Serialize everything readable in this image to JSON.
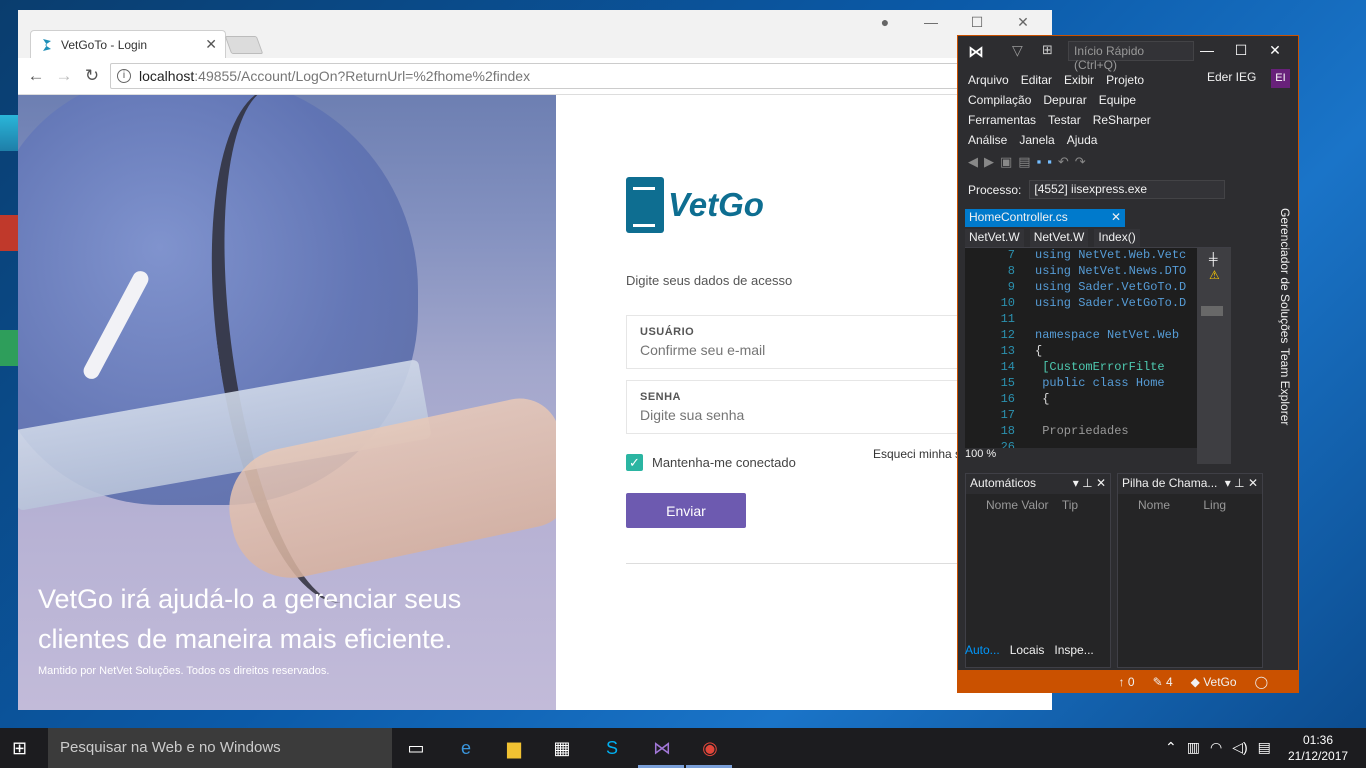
{
  "browser": {
    "tab_title": "VetGoTo - Login",
    "url_host": "localhost",
    "url_path": ":49855/Account/LogOn?ReturnUrl=%2fhome%2findex"
  },
  "login": {
    "logo_text": "VetGo",
    "intro": "Digite seus dados de acesso",
    "user_label": "USUÁRIO",
    "user_placeholder": "Confirme seu e-mail",
    "pass_label": "SENHA",
    "pass_placeholder": "Digite sua senha",
    "remember_label": "Mantenha-me conectado",
    "remember_checked": true,
    "forgot_label": "Esqueci minha s",
    "submit_label": "Enviar"
  },
  "hero": {
    "headline": "VetGo irá ajudá-lo a gerenciar seus clientes de maneira mais eficiente.",
    "footer": "Mantido por NetVet Soluções. Todos os direitos reservados."
  },
  "vs": {
    "quick_launch": "Início Rápido (Ctrl+Q)",
    "menu": [
      "Arquivo",
      "Editar",
      "Exibir",
      "Projeto",
      "Compilação",
      "Depurar",
      "Equipe",
      "Ferramentas",
      "Testar",
      "ReSharper",
      "Análise",
      "Janela",
      "Ajuda"
    ],
    "user": "Eder IEG",
    "avatar": "EI",
    "process_label": "Processo:",
    "process_value": "[4552] iisexpress.exe",
    "doc_tab": "HomeController.cs",
    "nav": [
      "NetVet.W",
      "NetVet.W",
      "Index()"
    ],
    "code": [
      {
        "n": "7",
        "t": "using NetVet.Web.Vetc"
      },
      {
        "n": "8",
        "t": "using NetVet.News.DTO"
      },
      {
        "n": "9",
        "t": "using Sader.VetGoTo.D"
      },
      {
        "n": "10",
        "t": "using Sader.VetGoTo.D"
      },
      {
        "n": "11",
        "t": ""
      },
      {
        "n": "12",
        "t": "namespace NetVet.Web"
      },
      {
        "n": "13",
        "t": "{"
      },
      {
        "n": "14",
        "t": "    [CustomErrorFilte"
      },
      {
        "n": "15",
        "t": "    public class Home"
      },
      {
        "n": "16",
        "t": "    {"
      },
      {
        "n": "17",
        "t": ""
      },
      {
        "n": "18",
        "t": "        Propriedades"
      },
      {
        "n": "26",
        "t": ""
      }
    ],
    "zoom": "100 %",
    "side_tabs": [
      "Gerenciador de Soluções",
      "Team Explorer"
    ],
    "pane_left_title": "Automáticos",
    "pane_left_cols": [
      "Nome",
      "Valor",
      "Tip"
    ],
    "pane_right_title": "Pilha de Chama...",
    "pane_right_cols": [
      "Nome",
      "Ling"
    ],
    "bottom_tabs": [
      "Auto...",
      "Locais",
      "Inspe..."
    ],
    "status": {
      "up": "0",
      "edits": "4",
      "repo": "VetGo"
    }
  },
  "taskbar": {
    "search_placeholder": "Pesquisar na Web e no Windows",
    "time": "01:36",
    "date": "21/12/2017"
  }
}
